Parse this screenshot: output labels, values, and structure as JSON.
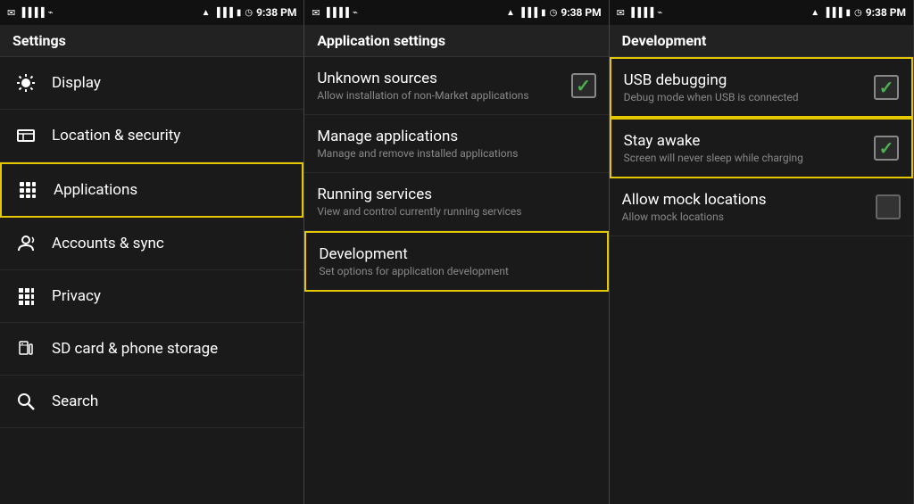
{
  "panels": [
    {
      "id": "settings",
      "statusBar": {
        "time": "9:38 PM"
      },
      "header": {
        "title": "Settings"
      },
      "items": [
        {
          "id": "display",
          "icon": "display",
          "title": "Display",
          "subtitle": "",
          "selected": false
        },
        {
          "id": "location",
          "icon": "location",
          "title": "Location & security",
          "subtitle": "",
          "selected": false
        },
        {
          "id": "applications",
          "icon": "apps",
          "title": "Applications",
          "subtitle": "",
          "selected": true
        },
        {
          "id": "accounts",
          "icon": "accounts",
          "title": "Accounts & sync",
          "subtitle": "",
          "selected": false
        },
        {
          "id": "privacy",
          "icon": "privacy",
          "title": "Privacy",
          "subtitle": "",
          "selected": false
        },
        {
          "id": "storage",
          "icon": "storage",
          "title": "SD card & phone storage",
          "subtitle": "",
          "selected": false
        },
        {
          "id": "search",
          "icon": "search",
          "title": "Search",
          "subtitle": "",
          "selected": false
        }
      ]
    },
    {
      "id": "application-settings",
      "statusBar": {
        "time": "9:38 PM"
      },
      "header": {
        "title": "Application settings"
      },
      "items": [
        {
          "id": "unknown-sources",
          "title": "Unknown sources",
          "subtitle": "Allow installation of non-Market applications",
          "selected": false,
          "hasCheckbox": true,
          "checked": true
        },
        {
          "id": "manage-apps",
          "title": "Manage applications",
          "subtitle": "Manage and remove installed applications",
          "selected": false,
          "hasCheckbox": false
        },
        {
          "id": "running-services",
          "title": "Running services",
          "subtitle": "View and control currently running services",
          "selected": false,
          "hasCheckbox": false
        },
        {
          "id": "development",
          "title": "Development",
          "subtitle": "Set options for application development",
          "selected": true,
          "hasCheckbox": false
        }
      ]
    },
    {
      "id": "development",
      "statusBar": {
        "time": "9:38 PM"
      },
      "header": {
        "title": "Development"
      },
      "items": [
        {
          "id": "usb-debugging",
          "title": "USB debugging",
          "subtitle": "Debug mode when USB is connected",
          "selected": true,
          "hasCheckbox": true,
          "checked": true
        },
        {
          "id": "stay-awake",
          "title": "Stay awake",
          "subtitle": "Screen will never sleep while charging",
          "selected": true,
          "hasCheckbox": true,
          "checked": true
        },
        {
          "id": "mock-locations",
          "title": "Allow mock locations",
          "subtitle": "Allow mock locations",
          "selected": false,
          "hasCheckbox": true,
          "checked": false
        }
      ]
    }
  ],
  "icons": {
    "display": "☀",
    "location": "⊞",
    "apps": "▦",
    "accounts": "↺",
    "privacy": "▦",
    "storage": "▪",
    "search": "⌕"
  }
}
